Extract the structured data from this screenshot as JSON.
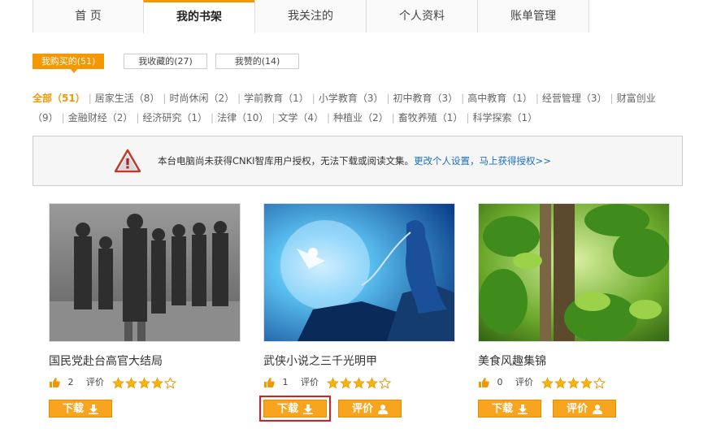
{
  "nav": {
    "tabs": [
      {
        "label": "首 页"
      },
      {
        "label": "我的书架"
      },
      {
        "label": "我关注的"
      },
      {
        "label": "个人资料"
      },
      {
        "label": "账单管理"
      }
    ]
  },
  "subtabs": [
    {
      "label": "我购买的(51)"
    },
    {
      "label": "我收藏的(27)"
    },
    {
      "label": "我赞的(14)"
    }
  ],
  "categories": {
    "all": "全部（51）",
    "items": [
      "居家生活（8）",
      "时尚休闲（2）",
      "学前教育（1）",
      "小学教育（3）",
      "初中教育（3）",
      "高中教育（1）",
      "经营管理（3）",
      "财富创业（9）",
      "金融财经（2）",
      "经济研究（1）",
      "法律（10）",
      "文学（4）",
      "种植业（2）",
      "畜牧养殖（1）",
      "科学探索（1）"
    ]
  },
  "notice": {
    "text": "本台电脑尚未获得CNKI智库用户授权，无法下载或阅读文集。",
    "link": "更改个人设置，马上获得授权>>"
  },
  "books": [
    {
      "title": "国民党赴台高官大结局",
      "likes": "2",
      "rate_label": "评价",
      "rating": 4,
      "download": "下载",
      "review": ""
    },
    {
      "title": "武侠小说之三千光明甲",
      "likes": "1",
      "rate_label": "评价",
      "rating": 4,
      "download": "下载",
      "review": "评价"
    },
    {
      "title": "美食风趣集锦",
      "likes": "0",
      "rate_label": "评价",
      "rating": 4,
      "download": "下载",
      "review": "评价"
    }
  ],
  "colors": {
    "accent": "#f39800",
    "button": "#f7a51e",
    "link": "#1a6fc0",
    "highlight": "#e21c1c"
  }
}
